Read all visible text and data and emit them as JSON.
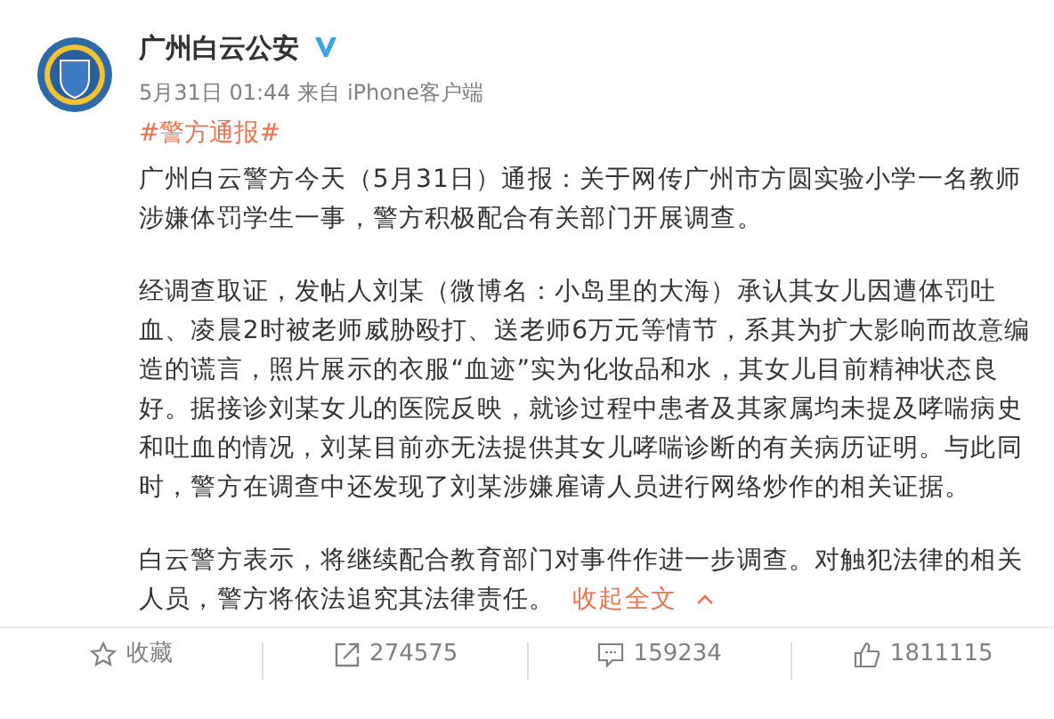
{
  "post": {
    "author": "广州白云公安",
    "verified": true,
    "time": "5月31日 01:44",
    "source": "来自 iPhone客户端",
    "hashtag": "#警方通报#",
    "paragraphs": [
      "广州白云警方今天（5月31日）通报：关于网传广州市方圆实验小学一名教师涉嫌体罚学生一事，警方积极配合有关部门开展调查。",
      "经调查取证，发帖人刘某（微博名：小岛里的大海）承认其女儿因遭体罚吐血、凌晨2时被老师威胁殴打、送老师6万元等情节，系其为扩大影响而故意编造的谎言，照片展示的衣服“血迹”实为化妆品和水，其女儿目前精神状态良好。据接诊刘某女儿的医院反映，就诊过程中患者及其家属均未提及哮喘病史和吐血的情况，刘某目前亦无法提供其女儿哮喘诊断的有关病历证明。与此同时，警方在调查中还发现了刘某涉嫌雇请人员进行网络炒作的相关证据。",
      "白云警方表示，将继续配合教育部门对事件作进一步调查。对触犯法律的相关人员，警方将依法追究其法律责任。"
    ],
    "collapse_link": "收起全文"
  },
  "actions": [
    {
      "kind": "favorite",
      "label": "收藏"
    },
    {
      "kind": "repost",
      "label": "274575"
    },
    {
      "kind": "comment",
      "label": "159234"
    },
    {
      "kind": "like",
      "label": "1811115"
    }
  ]
}
